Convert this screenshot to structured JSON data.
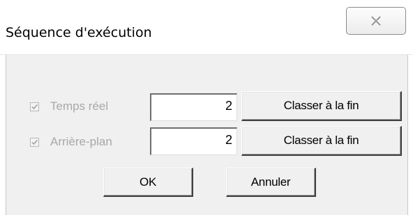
{
  "window": {
    "title": "Séquence d'exécution",
    "close_icon": "close-x-icon"
  },
  "rows": [
    {
      "label": "Temps réel",
      "checked": true,
      "enabled": false,
      "value": "2",
      "button_label": "Classer à la fin"
    },
    {
      "label": "Arrière-plan",
      "checked": true,
      "enabled": false,
      "value": "2",
      "button_label": "Classer à la fin"
    }
  ],
  "buttons": {
    "ok_label": "OK",
    "cancel_label": "Annuler"
  },
  "colors": {
    "dialog_face": "#f0f0f0",
    "disabled_text": "#a8a8a8"
  }
}
